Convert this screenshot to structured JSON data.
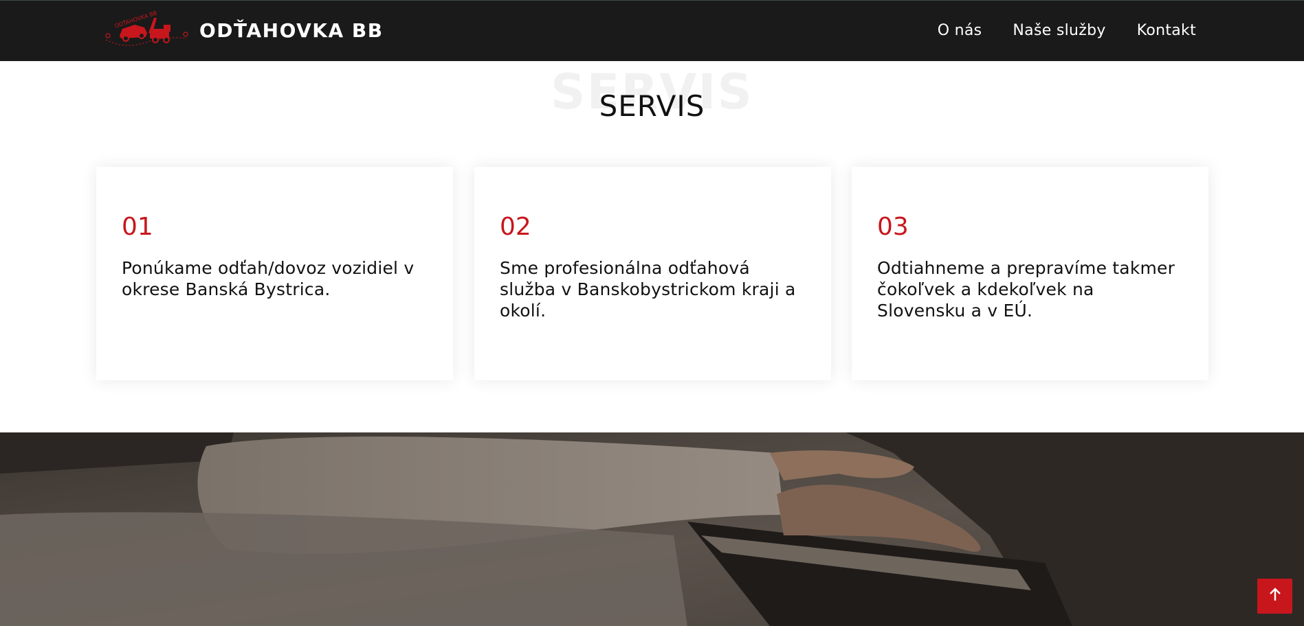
{
  "header": {
    "brand": "ODŤAHOVKA BB",
    "logo_text": "ODŤAHOVKA BB",
    "nav": [
      "O nás",
      "Naše služby",
      "Kontakt"
    ]
  },
  "section": {
    "ghost_title": "SERVIS",
    "title": "SERVIS",
    "cards": [
      {
        "number": "01",
        "text": "Ponúkame odťah/dovoz vozidiel v okrese Banská Bystrica."
      },
      {
        "number": "02",
        "text": "Sme profesionálna odťahová služba v Banskobystrickom kraji a okolí."
      },
      {
        "number": "03",
        "text": "Odtiahneme a prepravíme takmer čokoľvek a kdekoľvek na Slovensku a v EÚ."
      }
    ]
  },
  "colors": {
    "navbar_bg": "#1a1a1a",
    "accent": "#c8161d",
    "text": "#111111"
  },
  "icons": {
    "back_to_top": "arrow-up-icon",
    "logo": "tow-truck-logo"
  }
}
